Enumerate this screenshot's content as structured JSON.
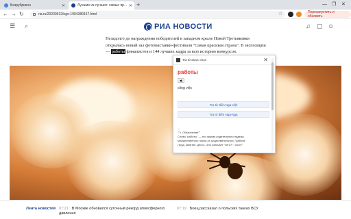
{
  "browser": {
    "tabs": [
      {
        "title": "Безрубрикон",
        "active": false,
        "favicon_color": "#4a7fe3"
      },
      {
        "title": "Лучшие из лучших: самые яр...",
        "active": true,
        "favicon_color": "#1a3f8f"
      }
    ],
    "new_tab_icon": "plus-icon",
    "url": "ria.ru/20230912/ngo-1904389157.html",
    "update_button": "Перезапустить и обновить"
  },
  "site": {
    "logo_text": "РИА НОВОСТИ",
    "brand_color": "#1a3f8f"
  },
  "article": {
    "para_before": "Незадолго до награждения победителей в западном крыле Новой Третьяковки открылась новый зал фотовыставки-фестиваля \"Самая красивая страна\". В экспозиции — ",
    "highlight": "работы",
    "para_after": " финалистов и 144 лучших кадра за всю историю конкурсов."
  },
  "popup": {
    "title": "Tra từ được chọn",
    "word": "работы",
    "speaker_icon": "speaker-icon",
    "meaning": "công việc",
    "btn_vi": "Tra từ điển Nga-Việt",
    "btn_ru": "Tra từ điển Nga-Nga",
    "entry_lines": [
      "—",
      "\"\"1. Объяснение\"\"",
      "Слово \"работы\" — это форма родительного падежа",
      "множественного числа от существительного \"работа\"",
      "(труд, занятие, дело). Оно означает \"чего?\", \"кого?\""
    ]
  },
  "footer": {
    "feed_label": "Лента новостей",
    "items": [
      {
        "time": "07:21",
        "text": "В Москве обновился суточный рекорд атмосферного давления"
      },
      {
        "time": "07:19",
        "text": "Боец рассказал о польских танках ВСУ"
      }
    ]
  }
}
